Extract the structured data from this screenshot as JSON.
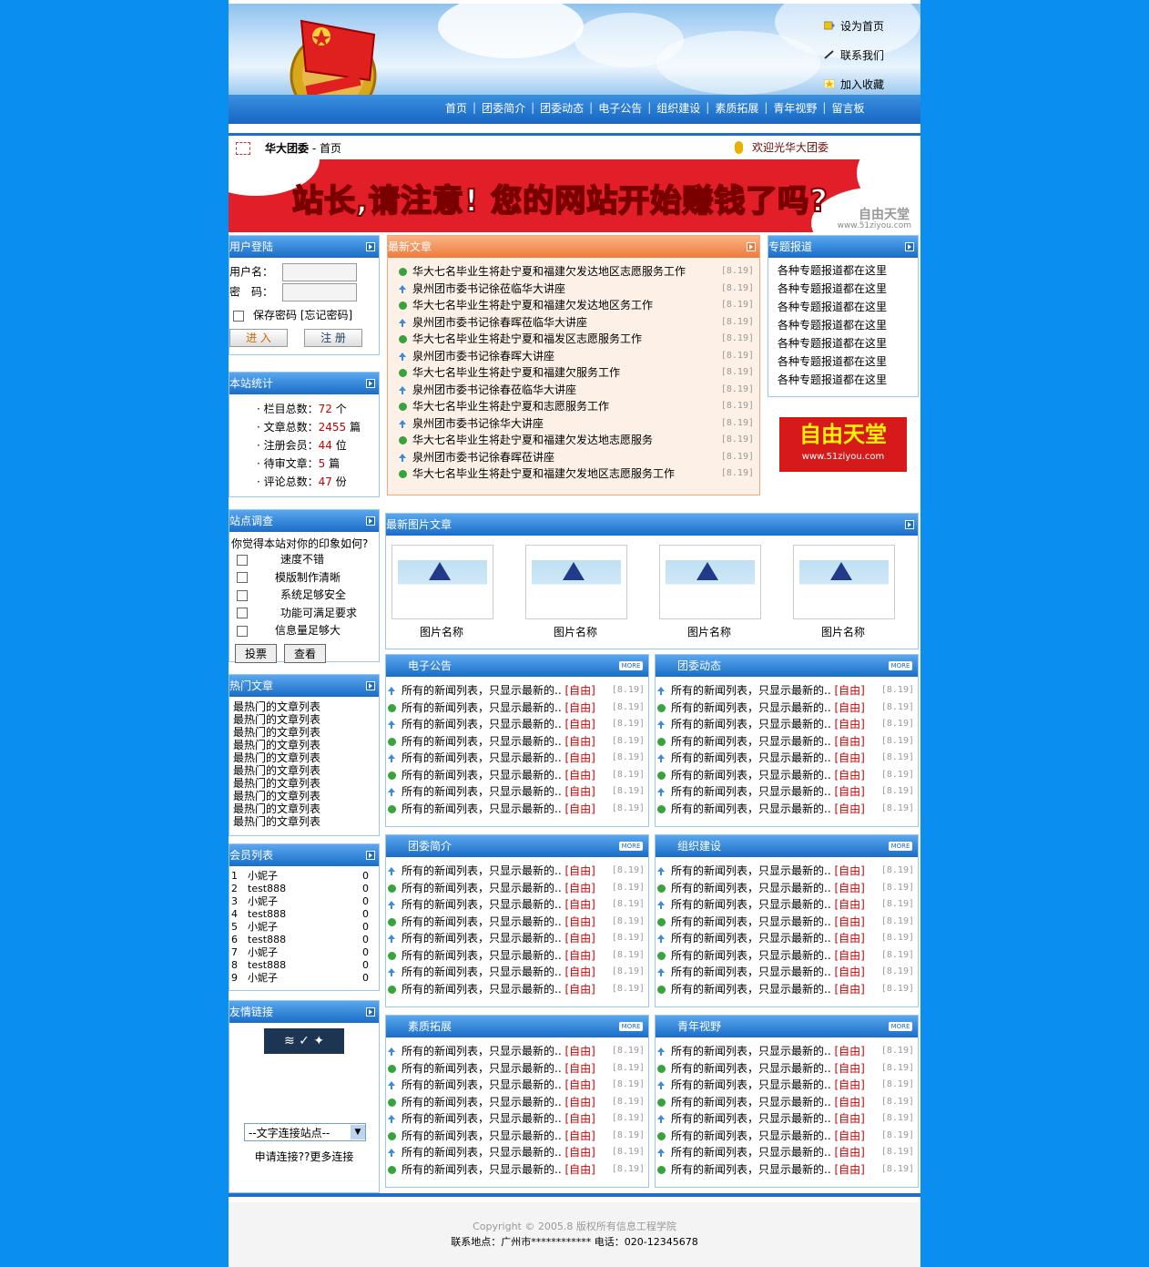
{
  "topnav": {
    "home": "设为首页",
    "contact": "联系我们",
    "fav": "加入收藏"
  },
  "nav": [
    "首页",
    "团委简介",
    "团委动态",
    "电子公告",
    "组织建设",
    "素质拓展",
    "青年视野",
    "留言板"
  ],
  "crumb": {
    "site": "华大团委",
    "sep": " - ",
    "page": "首页",
    "welcome": "欢迎光华大团委"
  },
  "banner": {
    "part1": "站长,请",
    "part2": "注意",
    "part3": "! 您的网站开始",
    "part4": "赚钱",
    "part5": "了吗?",
    "logo": "自由天堂",
    "url": "www.51ziyou.com"
  },
  "login": {
    "title": "用户登陆",
    "user_label": "用户名：",
    "pass_label": "密　码：",
    "remember": "保存密码",
    "forgot": "[忘记密码]",
    "enter": "进 入",
    "register": "注 册"
  },
  "stats": {
    "title": "本站统计",
    "items": [
      {
        "label": "栏目总数：",
        "value": "72",
        "unit": "个"
      },
      {
        "label": "文章总数：",
        "value": "2455",
        "unit": "篇"
      },
      {
        "label": "注册会员：",
        "value": "44",
        "unit": "位"
      },
      {
        "label": "待审文章：",
        "value": "5",
        "unit": "篇"
      },
      {
        "label": "评论总数：",
        "value": "47",
        "unit": "份"
      }
    ]
  },
  "survey": {
    "title": "站点调查",
    "question": "你觉得本站对你的印象如何?",
    "options": [
      "速度不错",
      "模版制作清晰",
      "系统足够安全",
      "功能可满足要求",
      "信息量足够大"
    ],
    "vote": "投票",
    "view": "查看"
  },
  "hot": {
    "title": "热门文章",
    "items": [
      "最热门的文章列表",
      "最热门的文章列表",
      "最热门的文章列表",
      "最热门的文章列表",
      "最热门的文章列表",
      "最热门的文章列表",
      "最热门的文章列表",
      "最热门的文章列表",
      "最热门的文章列表",
      "最热门的文章列表"
    ]
  },
  "members": {
    "title": "会员列表",
    "items": [
      {
        "n": "1",
        "name": "小妮子",
        "c": "0"
      },
      {
        "n": "2",
        "name": "test888",
        "c": "0"
      },
      {
        "n": "3",
        "name": "小妮子",
        "c": "0"
      },
      {
        "n": "4",
        "name": "test888",
        "c": "0"
      },
      {
        "n": "5",
        "name": "小妮子",
        "c": "0"
      },
      {
        "n": "6",
        "name": "test888",
        "c": "0"
      },
      {
        "n": "7",
        "name": "小妮子",
        "c": "0"
      },
      {
        "n": "8",
        "name": "test888",
        "c": "0"
      },
      {
        "n": "9",
        "name": "小妮子",
        "c": "0"
      }
    ]
  },
  "links": {
    "title": "友情链接",
    "select": "--文字连接站点--",
    "apply": "申请连接??更多连接"
  },
  "latest": {
    "title": "最新文章",
    "items": [
      "华大七名毕业生将赴宁夏和福建欠发达地区志愿服务工作",
      "泉州团市委书记徐莅临华大讲座",
      "华大七名毕业生将赴宁夏和福建欠发达地区务工作",
      "泉州团市委书记徐春晖莅临华大讲座",
      "华大七名毕业生将赴宁夏和福发区志愿服务工作",
      "泉州团市委书记徐春晖大讲座",
      "华大七名毕业生将赴宁夏和福建欠服务工作",
      "泉州团市委书记徐春莅临华大讲座",
      "华大七名毕业生将赴宁夏和志愿服务工作",
      "泉州团市委书记徐华大讲座",
      "华大七名毕业生将赴宁夏和福建欠发达地志愿服务",
      "泉州团市委书记徐春晖莅讲座",
      "华大七名毕业生将赴宁夏和福建欠发地区志愿服务工作"
    ],
    "date": "[8.19]"
  },
  "special": {
    "title": "专题报道",
    "items": [
      "各种专题报道都在这里",
      "各种专题报道都在这里",
      "各种专题报道都在这里",
      "各种专题报道都在这里",
      "各种专题报道都在这里",
      "各种专题报道都在这里",
      "各种专题报道都在这里"
    ],
    "ad": "自由天堂",
    "ad_url": "www.51ziyou.com"
  },
  "pics": {
    "title": "最新图片文章",
    "captions": [
      "图片名称",
      "图片名称",
      "图片名称",
      "图片名称"
    ]
  },
  "news_text": "所有的新闻列表，只显示最新的..",
  "news_tag": "[自由]",
  "news_date": "[8.19]",
  "more": "MORE",
  "sections": [
    "电子公告",
    "团委动态",
    "团委简介",
    "组织建设",
    "素质拓展",
    "青年视野"
  ],
  "footer": {
    "copy": "Copyright © 2005.8 版权所有信息工程学院",
    "contact": "联系地点：广州市************ 电话：020-12345678"
  }
}
